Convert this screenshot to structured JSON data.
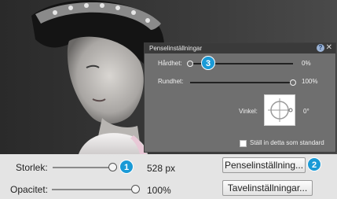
{
  "panel": {
    "title": "Penselinställningar",
    "help": "?",
    "close": "✕",
    "hardness": {
      "label": "Hårdhet:",
      "value": "0%",
      "level": 0
    },
    "roundness": {
      "label": "Rundhet:",
      "value": "100%",
      "level": 1
    },
    "angle": {
      "label": "Vinkel:",
      "value": "0°"
    },
    "default_label": "Ställ in detta som standard",
    "default_checked": false
  },
  "controls": {
    "size": {
      "label": "Storlek:",
      "value": "528 px"
    },
    "opacity": {
      "label": "Opacitet:",
      "value": "100%",
      "level": 1
    },
    "brush_settings_button": "Penselinställning...",
    "tablet_settings_button": "Tavelinställningar..."
  },
  "callouts": [
    "1",
    "2",
    "3"
  ]
}
